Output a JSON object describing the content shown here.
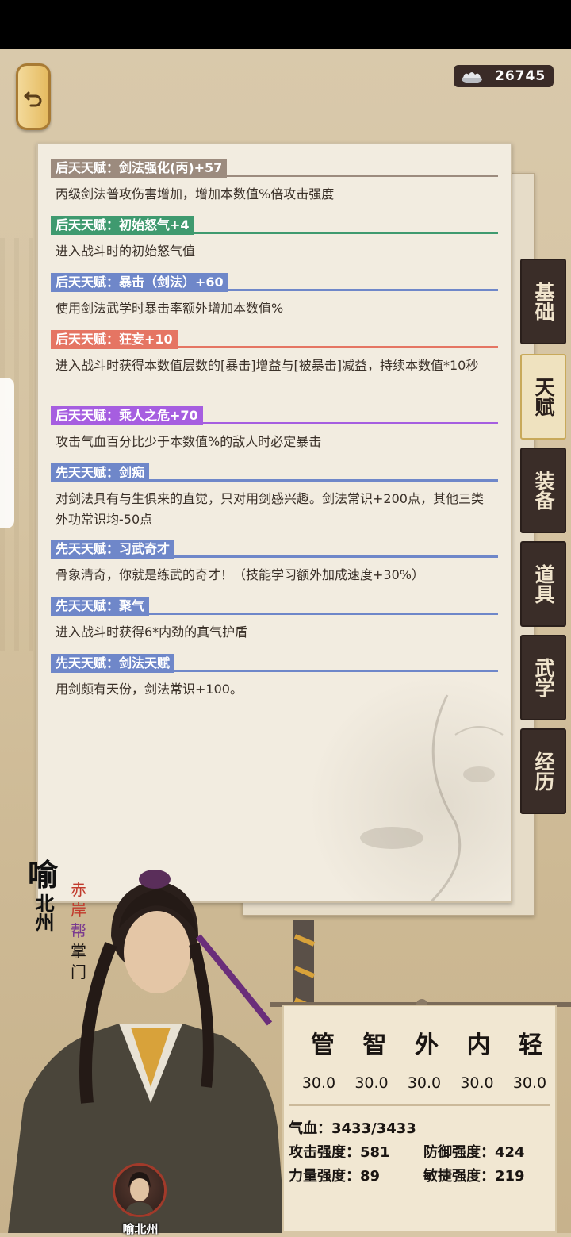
{
  "currency": {
    "icon": "silver-ingot-icon",
    "value": "26745"
  },
  "talents": [
    {
      "label": "后天天赋：剑法强化(丙)+57",
      "color": "#9c8b7e",
      "desc": "丙级剑法普攻伤害增加，增加本数值%倍攻击强度"
    },
    {
      "label": "后天天赋：初始怒气+4",
      "color": "#3f9a6f",
      "desc": "进入战斗时的初始怒气值"
    },
    {
      "label": "后天天赋：暴击（剑法）+60",
      "color": "#6f87c9",
      "desc": "使用剑法武学时暴击率额外增加本数值%"
    },
    {
      "label": "后天天赋：狂妄+10",
      "color": "#e57563",
      "desc": "进入战斗时获得本数值层数的[暴击]增益与[被暴击]减益，持续本数值*10秒"
    },
    {
      "label": "后天天赋：乘人之危+70",
      "color": "#a65ee0",
      "desc": "攻击气血百分比少于本数值%的敌人时必定暴击"
    },
    {
      "label": "先天天赋：剑痴",
      "color": "#6f87c9",
      "desc": "对剑法具有与生俱来的直觉，只对用剑感兴趣。剑法常识+200点，其他三类外功常识均-50点"
    },
    {
      "label": "先天天赋：习武奇才",
      "color": "#6f87c9",
      "desc": "骨象清奇，你就是练武的奇才！（技能学习额外加成速度+30%）"
    },
    {
      "label": "先天天赋：聚气",
      "color": "#6f87c9",
      "desc": "进入战斗时获得6*内劲的真气护盾"
    },
    {
      "label": "先天天赋：剑法天赋",
      "color": "#6f87c9",
      "desc": "用剑颇有天份，剑法常识+100。"
    }
  ],
  "tabs": [
    {
      "label": "基础",
      "active": false
    },
    {
      "label": "天赋",
      "active": true
    },
    {
      "label": "装备",
      "active": false
    },
    {
      "label": "道具",
      "active": false
    },
    {
      "label": "武学",
      "active": false
    },
    {
      "label": "经历",
      "active": false
    }
  ],
  "character": {
    "surname": "喻",
    "given": "北州",
    "sect": [
      "赤",
      "岸",
      "帮",
      "掌",
      "门"
    ],
    "sect_colors": [
      "#c13a2c",
      "#c13a2c",
      "#7a3a8f",
      "#1a1512",
      "#1a1512"
    ],
    "avatar_name": "喻北州"
  },
  "stats": {
    "attr_heads": [
      "管",
      "智",
      "外",
      "内",
      "轻"
    ],
    "attr_vals": [
      "30.0",
      "30.0",
      "30.0",
      "30.0",
      "30.0"
    ],
    "hp": "气血：3433/3433",
    "attack": "攻击强度：581",
    "defense": "防御强度：424",
    "strength": "力量强度：89",
    "agility": "敏捷强度：219"
  }
}
